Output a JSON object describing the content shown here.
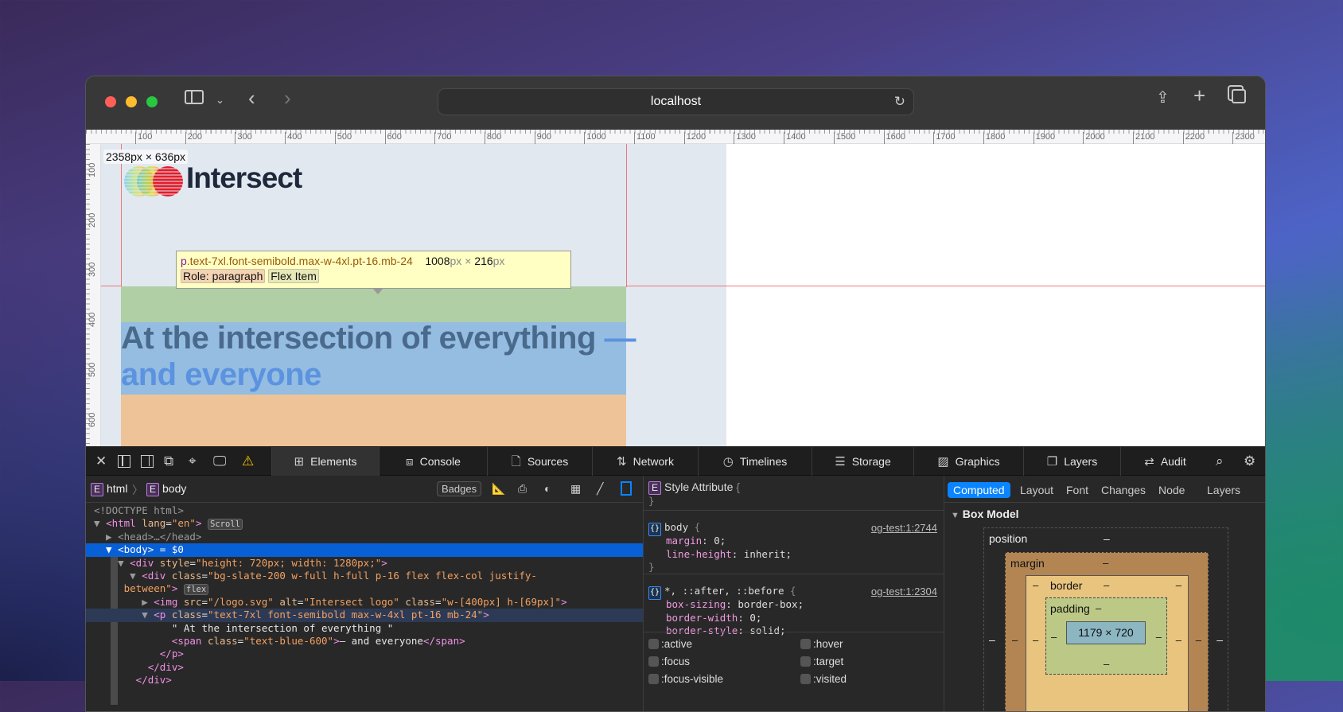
{
  "browser": {
    "url": "localhost",
    "toolbar_icons": [
      "sidebar-icon",
      "chevron-down-icon",
      "back-icon",
      "forward-icon",
      "reload-icon",
      "share-icon",
      "new-tab-icon",
      "tabs-overview-icon"
    ]
  },
  "ruler": {
    "top": [
      "100",
      "200",
      "300",
      "400",
      "500",
      "600",
      "700",
      "800",
      "900",
      "1000",
      "1100",
      "1200",
      "1300",
      "1400",
      "1500",
      "1600",
      "1700",
      "1800",
      "1900",
      "2000",
      "2100",
      "2200",
      "2300"
    ],
    "left": [
      "100",
      "200",
      "300",
      "400",
      "500",
      "600"
    ]
  },
  "page": {
    "size_label": "2358px × 636px",
    "logo_text": "Intersect",
    "headline": "At the intersection of everything ",
    "headline_accent": "— and everyone",
    "colors": {
      "slate": "#e2e8f0",
      "margin_overlay": "#b0cfa4",
      "content_overlay": "#95bde2",
      "padding_overlay": "#eec397",
      "accent": "#5b93e0"
    }
  },
  "tooltip": {
    "tag": "p",
    "selector": ".text-7xl.font-semibold.max-w-4xl.pt-16.mb-24",
    "width": "1008",
    "height": "216",
    "px": "px",
    "times": " × ",
    "role": "Role: paragraph",
    "flex": "Flex Item"
  },
  "devtools": {
    "tabs": [
      {
        "label": "Elements",
        "icon": "elements-icon"
      },
      {
        "label": "Console",
        "icon": "console-icon"
      },
      {
        "label": "Sources",
        "icon": "sources-icon"
      },
      {
        "label": "Network",
        "icon": "network-icon"
      },
      {
        "label": "Timelines",
        "icon": "timelines-icon"
      },
      {
        "label": "Storage",
        "icon": "storage-icon"
      },
      {
        "label": "Graphics",
        "icon": "graphics-icon"
      },
      {
        "label": "Layers",
        "icon": "layers-icon"
      },
      {
        "label": "Audit",
        "icon": "audit-icon"
      }
    ],
    "active_tab": "Elements",
    "breadcrumb": [
      "html",
      "body"
    ],
    "badges_label": "Badges",
    "dom": [
      [
        [
          "gr",
          "<!DOCTYPE html>"
        ]
      ],
      [
        [
          "gr",
          "▼ "
        ],
        [
          "t",
          "<html "
        ],
        [
          "an",
          "lang"
        ],
        [
          "tx",
          "="
        ],
        [
          "av",
          "\"en\""
        ],
        [
          "t",
          ">"
        ],
        [
          "tx",
          " "
        ],
        [
          "badge",
          "Scroll"
        ]
      ],
      [
        [
          "gr",
          "  ▶ <head>…</head>"
        ]
      ],
      [
        [
          "tx",
          "  ▼ "
        ],
        [
          "t",
          "<body>"
        ],
        [
          "tx",
          " = $0"
        ]
      ],
      [
        [
          "gr",
          "    ▼ "
        ],
        [
          "t",
          "<div "
        ],
        [
          "an",
          "style"
        ],
        [
          "tx",
          "="
        ],
        [
          "av",
          "\"height: 720px; width: 1280px;\""
        ],
        [
          "t",
          ">"
        ]
      ],
      [
        [
          "gr",
          "      ▼ "
        ],
        [
          "t",
          "<div "
        ],
        [
          "an",
          "class"
        ],
        [
          "tx",
          "="
        ],
        [
          "av",
          "\"bg-slate-200 w-full h-full p-16 flex flex-col justify-"
        ]
      ],
      [
        [
          "av",
          "     between\""
        ],
        [
          "t",
          ">"
        ],
        [
          "tx",
          " "
        ],
        [
          "badge",
          "flex"
        ]
      ],
      [
        [
          "gr",
          "        ▶ "
        ],
        [
          "t",
          "<img "
        ],
        [
          "an",
          "src"
        ],
        [
          "tx",
          "="
        ],
        [
          "av",
          "\"/logo.svg\""
        ],
        [
          "an",
          " alt"
        ],
        [
          "tx",
          "="
        ],
        [
          "av",
          "\"Intersect logo\""
        ],
        [
          "an",
          " class"
        ],
        [
          "tx",
          "="
        ],
        [
          "av",
          "\"w-[400px] h-[69px]\""
        ],
        [
          "t",
          ">"
        ]
      ],
      [
        [
          "gr",
          "        ▼ "
        ],
        [
          "t",
          "<p "
        ],
        [
          "an",
          "class"
        ],
        [
          "tx",
          "="
        ],
        [
          "av",
          "\"text-7xl font-semibold max-w-4xl pt-16 mb-24\""
        ],
        [
          "t",
          ">"
        ]
      ],
      [
        [
          "tx",
          "             \" At the intersection of everything \""
        ]
      ],
      [
        [
          "t",
          "             <span "
        ],
        [
          "an",
          "class"
        ],
        [
          "tx",
          "="
        ],
        [
          "av",
          "\"text-blue-600\""
        ],
        [
          "t",
          ">"
        ],
        [
          "tx",
          "— and everyone"
        ],
        [
          "t",
          "</span>"
        ]
      ],
      [
        [
          "t",
          "           </p>"
        ]
      ],
      [
        [
          "t",
          "         </div>"
        ]
      ],
      [
        [
          "t",
          "       </div>"
        ]
      ]
    ],
    "styles": {
      "style_attr": "Style Attribute",
      "rules": [
        {
          "selector": "body",
          "source": "og-test:1:2744",
          "props": [
            [
              "margin",
              "0"
            ],
            [
              "line-height",
              "inherit"
            ]
          ]
        },
        {
          "selector": "*, ::after, ::before",
          "source": "og-test:1:2304",
          "props": [
            [
              "box-sizing",
              "border-box"
            ],
            [
              "border-width",
              "0"
            ],
            [
              "border-style",
              "solid"
            ]
          ]
        }
      ],
      "pseudo": [
        ":active",
        ":hover",
        ":focus",
        ":target",
        ":focus-visible",
        ":visited"
      ]
    },
    "sidebar": {
      "tabs": [
        "Computed",
        "Layout",
        "Font",
        "Changes",
        "Node",
        "Layers"
      ],
      "active": "Computed",
      "section": "Box Model",
      "box": {
        "position": "position",
        "margin": "margin",
        "border": "border",
        "padding": "padding",
        "content": "1179 × 720",
        "dash": "–"
      }
    }
  }
}
